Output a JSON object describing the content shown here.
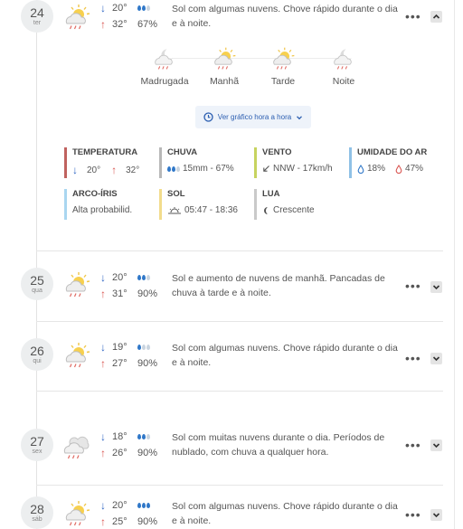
{
  "colors": {
    "arrow_min": "#2f66c4",
    "arrow_max": "#d9534f",
    "rain_drop": "#2f77c8",
    "temperature_bar": "#c0625f",
    "rain_bar": "#b8b8b8",
    "wind_bar": "#c7d35f",
    "humidity_bar": "#8fc1e6",
    "rainbow_bar": "#a9d6f0",
    "sun_bar": "#f2dc8c",
    "moon_bar": "#c9c9c9"
  },
  "days": [
    {
      "day": "24",
      "dow": "ter",
      "icon": "sun-cloud-rain-icon",
      "min": "20°",
      "max": "32°",
      "drops_filled": 2,
      "drops_total": 3,
      "rain_prob": "67%",
      "description": "Sol com algumas nuvens. Chove rápido durante o dia e à noite.",
      "expanded": true
    },
    {
      "day": "25",
      "dow": "qua",
      "icon": "sun-cloud-rain-icon",
      "min": "20°",
      "max": "31°",
      "drops_filled": 2,
      "drops_total": 3,
      "rain_prob": "90%",
      "description": "Sol e aumento de nuvens de manhã. Pancadas de chuva à tarde e à noite.",
      "expanded": false
    },
    {
      "day": "26",
      "dow": "qui",
      "icon": "sun-cloud-rain-icon",
      "min": "19°",
      "max": "27°",
      "drops_filled": 1,
      "drops_total": 3,
      "rain_prob": "90%",
      "description": "Sol com algumas nuvens. Chove rápido durante o dia e à noite.",
      "expanded": false
    },
    {
      "day": "27",
      "dow": "sex",
      "icon": "cloud-rain-icon",
      "min": "18°",
      "max": "26°",
      "drops_filled": 2,
      "drops_total": 3,
      "rain_prob": "90%",
      "description": "Sol com muitas nuvens durante o dia. Períodos de nublado, com chuva a qualquer hora.",
      "expanded": false
    },
    {
      "day": "28",
      "dow": "sáb",
      "icon": "sun-cloud-rain-icon",
      "min": "20°",
      "max": "25°",
      "drops_filled": 3,
      "drops_total": 3,
      "rain_prob": "90%",
      "description": "Sol com algumas nuvens. Chove rápido durante o dia e à noite.",
      "expanded": false
    }
  ],
  "periods": [
    {
      "label": "Madrugada",
      "icon": "moon-cloud-rain-icon"
    },
    {
      "label": "Manhã",
      "icon": "sun-cloud-rain-icon"
    },
    {
      "label": "Tarde",
      "icon": "sun-cloud-rain-icon"
    },
    {
      "label": "Noite",
      "icon": "moon-cloud-rain-icon"
    }
  ],
  "hourly_button": "Ver gráfico hora a hora",
  "details": {
    "temperature": {
      "title": "TEMPERATURA",
      "min": "20°",
      "max": "32°"
    },
    "rain": {
      "title": "CHUVA",
      "value": "15mm - 67%"
    },
    "wind": {
      "title": "VENTO",
      "value": "NNW - 17km/h"
    },
    "humidity": {
      "title": "UMIDADE DO AR",
      "min": "18%",
      "max": "47%"
    },
    "rainbow": {
      "title": "ARCO-ÍRIS",
      "value": "Alta probabilid."
    },
    "sun": {
      "title": "SOL",
      "value": "05:47 - 18:36"
    },
    "moon": {
      "title": "LUA",
      "value": "Crescente"
    }
  }
}
